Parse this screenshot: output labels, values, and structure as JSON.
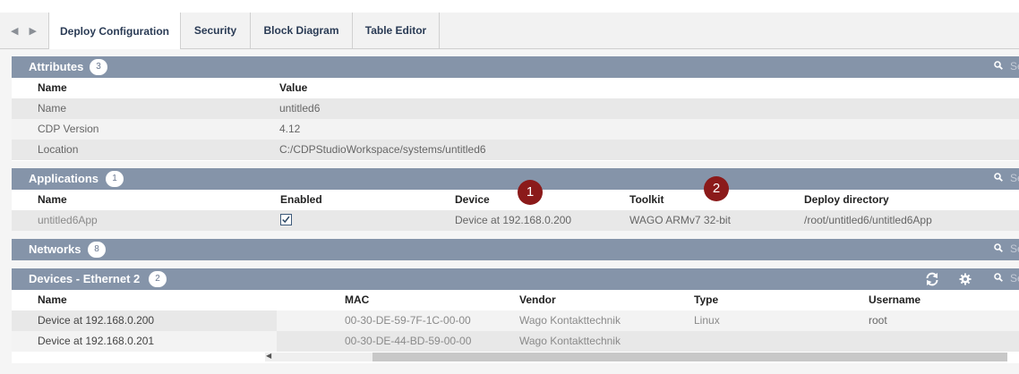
{
  "tabs": [
    "Deploy Configuration",
    "Security",
    "Block Diagram",
    "Table Editor"
  ],
  "search_partial": "Se",
  "attributes": {
    "title": "Attributes",
    "count": "3",
    "headers": [
      "Name",
      "Value"
    ],
    "rows": [
      {
        "name": "Name",
        "value": "untitled6"
      },
      {
        "name": "CDP Version",
        "value": "4.12"
      },
      {
        "name": "Location",
        "value": "C:/CDPStudioWorkspace/systems/untitled6"
      }
    ]
  },
  "applications": {
    "title": "Applications",
    "count": "1",
    "headers": [
      "Name",
      "Enabled",
      "Device",
      "Toolkit",
      "Deploy directory"
    ],
    "rows": [
      {
        "name": "untitled6App",
        "enabled": true,
        "device": "Device at 192.168.0.200",
        "toolkit": "WAGO ARMv7 32-bit",
        "dir": "/root/untitled6/untitled6App"
      }
    ]
  },
  "networks": {
    "title": "Networks",
    "count": "8"
  },
  "devices": {
    "title": "Devices - Ethernet 2",
    "count": "2",
    "headers": [
      "Name",
      "MAC",
      "Vendor",
      "Type",
      "Username"
    ],
    "rows": [
      {
        "name": "Device at 192.168.0.200",
        "mac": "00-30-DE-59-7F-1C-00-00",
        "vendor": "Wago Kontakttechnik",
        "type": "Linux",
        "username": "root"
      },
      {
        "name": "Device at 192.168.0.201",
        "mac": "00-30-DE-44-BD-59-00-00",
        "vendor": "Wago Kontakttechnik",
        "type": "",
        "username": ""
      }
    ]
  },
  "markers": [
    "1",
    "2"
  ]
}
